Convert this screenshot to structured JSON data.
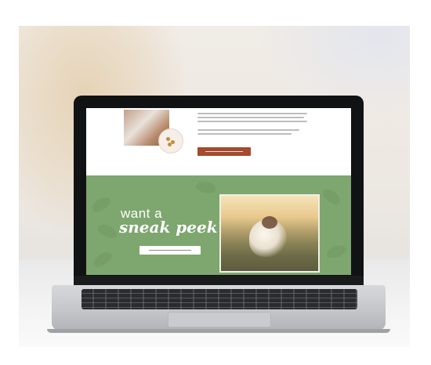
{
  "hero": {
    "line1": "want a",
    "line2": "sneak peek?"
  },
  "colors": {
    "green_section": "#7ea66f",
    "cta_top": "#a44a2e",
    "cta_peek": "#ffffff"
  }
}
